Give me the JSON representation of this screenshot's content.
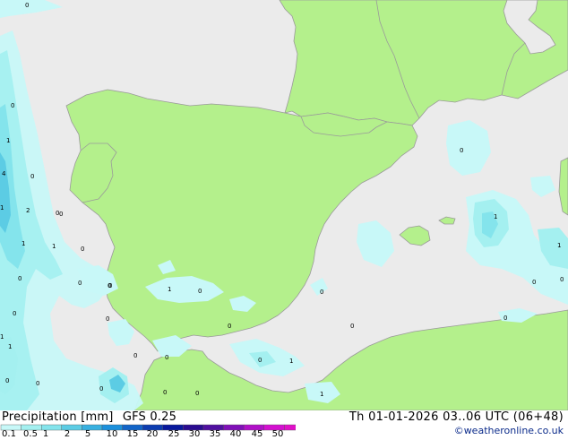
{
  "legend": {
    "title": "Precipitation [mm]",
    "model": "GFS 0.25",
    "colors": [
      "#c8f8f8",
      "#a4f0f0",
      "#84e4ec",
      "#5ccce4",
      "#38b0e0",
      "#1c90dc",
      "#1264c8",
      "#0c3cb0",
      "#08189c",
      "#2a0c90",
      "#5010a0",
      "#8010b8",
      "#b010c8",
      "#d410d0",
      "#e010c8"
    ],
    "ticks": [
      "0.1",
      "0.5",
      "1",
      "2",
      "5",
      "10",
      "15",
      "20",
      "25",
      "30",
      "35",
      "40",
      "45",
      "50"
    ]
  },
  "run_info": "Th 01-01-2026 03..06 UTC (06+48)",
  "copyright": "©weatheronline.co.uk",
  "map_values": [
    {
      "id": "v1",
      "text": "0"
    },
    {
      "id": "v2",
      "text": "0"
    },
    {
      "id": "v3",
      "text": "1"
    },
    {
      "id": "v4",
      "text": "4"
    },
    {
      "id": "v5",
      "text": "0"
    },
    {
      "id": "v6",
      "text": "1"
    },
    {
      "id": "v7",
      "text": "2"
    },
    {
      "id": "v8",
      "text": "0"
    },
    {
      "id": "v9",
      "text": "1"
    },
    {
      "id": "v10",
      "text": "1"
    },
    {
      "id": "v11",
      "text": "0"
    },
    {
      "id": "v12",
      "text": "0"
    },
    {
      "id": "v13",
      "text": "0"
    },
    {
      "id": "v14",
      "text": "0"
    },
    {
      "id": "v15",
      "text": "1"
    },
    {
      "id": "v16",
      "text": "0"
    },
    {
      "id": "v17",
      "text": "0"
    },
    {
      "id": "v18",
      "text": "0"
    },
    {
      "id": "v19",
      "text": "0"
    },
    {
      "id": "v20",
      "text": "1"
    },
    {
      "id": "v21",
      "text": "0"
    },
    {
      "id": "v22",
      "text": "0"
    },
    {
      "id": "v23",
      "text": "1"
    },
    {
      "id": "v24",
      "text": "0"
    },
    {
      "id": "v25",
      "text": "0"
    },
    {
      "id": "v26",
      "text": "0"
    },
    {
      "id": "v27",
      "text": "1"
    },
    {
      "id": "v28",
      "text": "0"
    },
    {
      "id": "v29",
      "text": "0"
    },
    {
      "id": "v30",
      "text": "0"
    },
    {
      "id": "v31",
      "text": "0"
    },
    {
      "id": "v32",
      "text": "0"
    },
    {
      "id": "v33",
      "text": "1"
    },
    {
      "id": "v34",
      "text": "0"
    },
    {
      "id": "v35",
      "text": "1"
    },
    {
      "id": "v36",
      "text": "0"
    },
    {
      "id": "v37",
      "text": "0"
    },
    {
      "id": "v38",
      "text": "1"
    },
    {
      "id": "v39",
      "text": "0"
    },
    {
      "id": "v40",
      "text": "0"
    },
    {
      "id": "v41",
      "text": "0"
    }
  ]
}
